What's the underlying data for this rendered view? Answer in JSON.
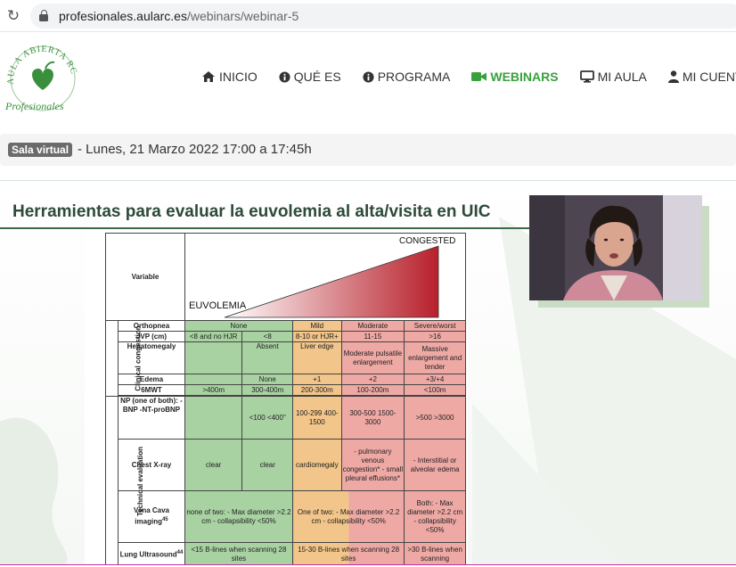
{
  "browser": {
    "url_domain": "profesionales.aularc.es",
    "url_path": "/webinars/webinar-5"
  },
  "logo": {
    "arc_text": "AULA ABIERTA RC",
    "script_text": "Profesionales",
    "color": "#3a8f3c"
  },
  "nav": {
    "items": [
      {
        "label": "INICIO",
        "icon": "home-icon"
      },
      {
        "label": "QUÉ ES",
        "icon": "info-icon"
      },
      {
        "label": "PROGRAMA",
        "icon": "info-icon"
      },
      {
        "label": "WEBINARS",
        "icon": "video-camera-icon",
        "active": true
      },
      {
        "label": "MI AULA",
        "icon": "monitor-icon"
      },
      {
        "label": "MI CUENTA",
        "icon": "user-icon"
      }
    ],
    "active_color": "#38a13d"
  },
  "session": {
    "badge": "Sala virtual",
    "text": "- Lunes, 21 Marzo 2022 17:00 a 17:45h"
  },
  "slide": {
    "title": "Herramientas para evaluar la euvolemia al alta/visita en UIC",
    "variable_label": "Variable",
    "euvolemia_label": "EUVOLEMIA",
    "congested_label": "CONGESTED",
    "group_clinical": "Clinical congestion",
    "group_technical": "Technical evaluation",
    "severity": [
      "None",
      "Mild",
      "Moderate",
      "Severe/worst"
    ],
    "rows": {
      "orthopnea": "Orthopnea",
      "jvp": {
        "label": "JVP (cm)",
        "c1": "<8 and no HJR",
        "c2": "<8",
        "c3": "8-10 or HJR+",
        "c4": "11-15",
        "c5": ">16"
      },
      "hepatomegaly": {
        "label": "Hepatomegaly",
        "c2": "Absent",
        "c3": "Liver edge",
        "c4": "Moderate pulsatile enlargement",
        "c5": "Massive enlargement and tender"
      },
      "edema": {
        "label": "Edema",
        "c2": "None",
        "c3": "+1",
        "c4": "+2",
        "c5": "+3/+4"
      },
      "mwt": {
        "label": "6MWT",
        "c1": ">400m",
        "c2": "300-400m",
        "c3": "200-300m",
        "c4": "100-200m",
        "c5": "<100m"
      },
      "np": {
        "label": "NP (one of both): -BNP -NT-proBNP",
        "c2": "<100 <400\"",
        "c3": "100-299 400-1500",
        "c4": "300-500 1500-3000",
        "c5": ">500 >3000"
      },
      "xray": {
        "label": "Chest X-ray",
        "c1": "clear",
        "c2": "clear",
        "c3": "cardiomegaly",
        "c4": "- pulmonary venous congestion* - small pleural effusions*",
        "c5": "- Interstitial or alveolar edema"
      },
      "vena": {
        "label": "Vena Cava imaging",
        "sup": "45",
        "g": "none of two: - Max diameter >2.2 cm - collapsibility <50%",
        "m": "One of two: - Max diameter >2.2 cm - collapsibility <50%",
        "s": "Both: - Max diameter >2.2 cm - collapsibility <50%"
      },
      "lung": {
        "label": "Lung Ultrasound",
        "sup": "44",
        "g": "<15 B-lines when scanning 28 sites",
        "m": "15-30 B-lines when scanning 28 sites",
        "s": ">30 B-lines when scanning"
      }
    }
  }
}
